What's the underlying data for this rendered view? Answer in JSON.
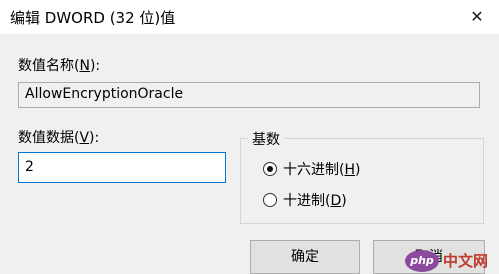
{
  "window": {
    "title": "编辑 DWORD (32 位)值",
    "close_glyph": "✕"
  },
  "value_name": {
    "label_prefix": "数值名称(",
    "label_accel": "N",
    "label_suffix": "):",
    "value": "AllowEncryptionOracle"
  },
  "value_data": {
    "label_prefix": "数值数据(",
    "label_accel": "V",
    "label_suffix": "):",
    "value": "2"
  },
  "base": {
    "title": "基数",
    "options": [
      {
        "prefix": "十六进制(",
        "accel": "H",
        "suffix": ")",
        "checked": true
      },
      {
        "prefix": "十进制(",
        "accel": "D",
        "suffix": ")",
        "checked": false
      }
    ]
  },
  "buttons": {
    "ok": "确定",
    "cancel": "取消"
  },
  "watermark": {
    "logo": "php",
    "text": "中文网"
  }
}
